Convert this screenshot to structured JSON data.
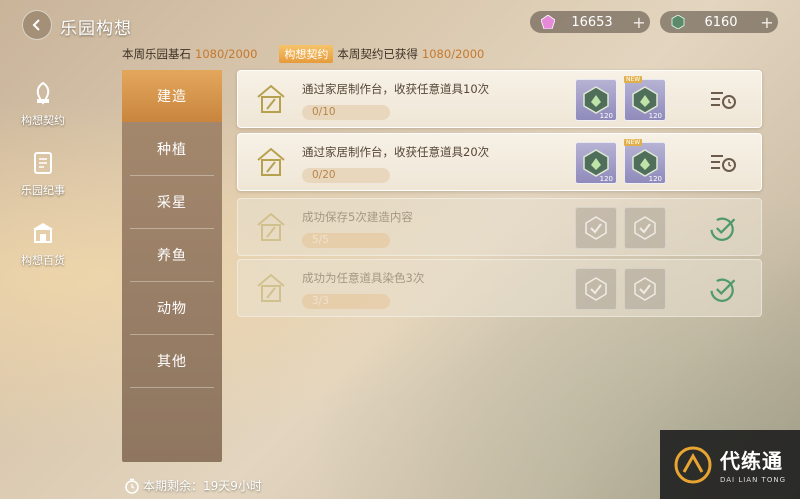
{
  "header": {
    "title": "乐园构想",
    "currencies": [
      {
        "amount": "16653",
        "icon": "pink-gem-icon",
        "plus": "+"
      },
      {
        "amount": "6160",
        "icon": "green-crystal-icon",
        "plus": "+"
      }
    ]
  },
  "stats": {
    "foundation_label": "本周乐园基石",
    "foundation_value": "1080/2000",
    "contract_tag": "构想契约",
    "contract_label": "本周契约已获得",
    "contract_value": "1080/2000"
  },
  "leftnav": [
    {
      "label": "构想契约",
      "icon": "contract-icon"
    },
    {
      "label": "乐园纪事",
      "icon": "chronicle-icon"
    },
    {
      "label": "构想百货",
      "icon": "store-icon"
    }
  ],
  "categories": [
    "建造",
    "种植",
    "采星",
    "养鱼",
    "动物",
    "其他"
  ],
  "active_category": "建造",
  "tasks": [
    {
      "desc": "通过家居制作台，收获任意道具10次",
      "progress": "0/10",
      "done": false,
      "rewards": [
        {
          "amount": "120"
        },
        {
          "amount": "120",
          "tag": "NEW"
        }
      ]
    },
    {
      "desc": "通过家居制作台，收获任意道具20次",
      "progress": "0/20",
      "done": false,
      "rewards": [
        {
          "amount": "120"
        },
        {
          "amount": "120",
          "tag": "NEW"
        }
      ]
    },
    {
      "desc": "成功保存5次建造内容",
      "progress": "5/5",
      "done": true,
      "rewards": [
        {
          "amount": ""
        },
        {
          "amount": ""
        }
      ]
    },
    {
      "desc": "成功为任意道具染色3次",
      "progress": "3/3",
      "done": true,
      "rewards": [
        {
          "amount": ""
        },
        {
          "amount": ""
        }
      ]
    }
  ],
  "footer": {
    "remaining": "本期剩余：19天9小时"
  },
  "logo": {
    "name": "代练通",
    "sub": "DAI LIAN TONG"
  },
  "colors": {
    "accent": "#e3a75c",
    "highlight": "#c5792e",
    "check": "#4f9a6a"
  }
}
